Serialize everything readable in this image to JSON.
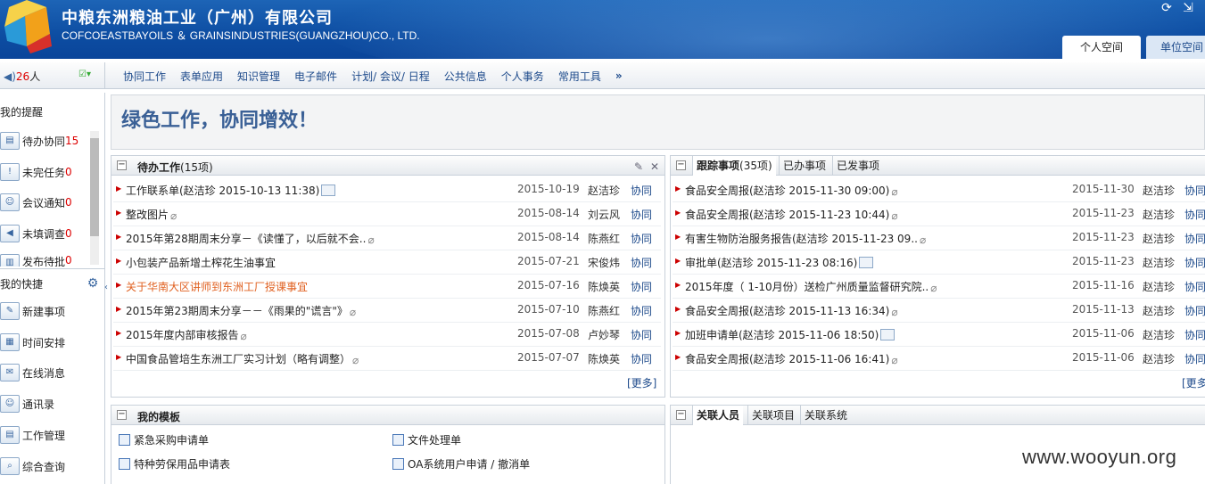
{
  "header": {
    "company_cn": "中粮东洲粮油工业（广州）有限公司",
    "company_en": "COFCOEASTBAYOILS ＆ GRAINSINDUSTRIES(GUANGZHOU)CO., LTD.",
    "tabs": [
      "个人空间",
      "单位空间"
    ]
  },
  "toolbar": {
    "online_count": "26",
    "online_unit": "人",
    "nav": [
      "协同工作",
      "表单应用",
      "知识管理",
      "电子邮件",
      "计划/ 会议/ 日程",
      "公共信息",
      "个人事务",
      "常用工具",
      "»"
    ]
  },
  "sidebar": {
    "reminders_title": "我的提醒",
    "reminders": [
      {
        "label": "待办协同",
        "count": "15"
      },
      {
        "label": "未完任务",
        "count": "0"
      },
      {
        "label": "会议通知",
        "count": "0"
      },
      {
        "label": "未填调查",
        "count": "0"
      },
      {
        "label": "发布待批",
        "count": "0"
      }
    ],
    "shortcuts_title": "我的快捷",
    "shortcuts": [
      "新建事项",
      "时间安排",
      "在线消息",
      "通讯录",
      "工作管理",
      "综合查询"
    ]
  },
  "banner": {
    "slogan": "绿色工作，协同增效！"
  },
  "pending": {
    "title": "待办工作",
    "count": "(15项)",
    "more": "[更多]",
    "rows": [
      {
        "title": "工作联系单(赵洁珍 2015-10-13 11:38)",
        "date": "2015-10-19",
        "user": "赵洁珍",
        "type": "协同",
        "mark": "doc",
        "hl": false
      },
      {
        "title": "整改图片",
        "date": "2015-08-14",
        "user": "刘云风",
        "type": "协同",
        "mark": "att",
        "hl": false
      },
      {
        "title": "2015年第28期周末分享－《读懂了，以后就不会..",
        "date": "2015-08-14",
        "user": "陈燕红",
        "type": "协同",
        "mark": "att",
        "hl": false
      },
      {
        "title": "小包装产品新增土榨花生油事宜",
        "date": "2015-07-21",
        "user": "宋俊炜",
        "type": "协同",
        "mark": "",
        "hl": false
      },
      {
        "title": "关于华南大区讲师到东洲工厂授课事宜",
        "date": "2015-07-16",
        "user": "陈焕英",
        "type": "协同",
        "mark": "",
        "hl": true
      },
      {
        "title": "2015年第23期周末分享－－《雨果的\"谎言\"》",
        "date": "2015-07-10",
        "user": "陈燕红",
        "type": "协同",
        "mark": "att",
        "hl": false
      },
      {
        "title": "2015年度内部审核报告",
        "date": "2015-07-08",
        "user": "卢妙琴",
        "type": "协同",
        "mark": "att",
        "hl": false
      },
      {
        "title": "中国食品管培生东洲工厂实习计划（略有调整）",
        "date": "2015-07-07",
        "user": "陈焕英",
        "type": "协同",
        "mark": "att",
        "hl": false
      }
    ]
  },
  "tracking": {
    "tabs": [
      "跟踪事项",
      "已办事项",
      "已发事项"
    ],
    "count": "(35项)",
    "more": "[更多",
    "rows": [
      {
        "title": "食品安全周报(赵洁珍 2015-11-30 09:00)",
        "date": "2015-11-30",
        "user": "赵洁珍",
        "type": "协同",
        "mark": "att"
      },
      {
        "title": "食品安全周报(赵洁珍 2015-11-23 10:44)",
        "date": "2015-11-23",
        "user": "赵洁珍",
        "type": "协同",
        "mark": "att"
      },
      {
        "title": "有害生物防治服务报告(赵洁珍 2015-11-23 09..",
        "date": "2015-11-23",
        "user": "赵洁珍",
        "type": "协同",
        "mark": "att"
      },
      {
        "title": "审批单(赵洁珍 2015-11-23 08:16)",
        "date": "2015-11-23",
        "user": "赵洁珍",
        "type": "协同",
        "mark": "doc"
      },
      {
        "title": "2015年度（ 1-10月份）送检广州质量监督研究院..",
        "date": "2015-11-16",
        "user": "赵洁珍",
        "type": "协同",
        "mark": "att"
      },
      {
        "title": "食品安全周报(赵洁珍 2015-11-13 16:34)",
        "date": "2015-11-13",
        "user": "赵洁珍",
        "type": "协同",
        "mark": "att"
      },
      {
        "title": "加班申请单(赵洁珍 2015-11-06 18:50)",
        "date": "2015-11-06",
        "user": "赵洁珍",
        "type": "协同",
        "mark": "doc"
      },
      {
        "title": "食品安全周报(赵洁珍 2015-11-06 16:41)",
        "date": "2015-11-06",
        "user": "赵洁珍",
        "type": "协同",
        "mark": "att"
      }
    ]
  },
  "templates": {
    "title": "我的模板",
    "items": [
      "紧急采购申请单",
      "文件处理单",
      "特种劳保用品申请表",
      "OA系统用户申请 / 撤消单"
    ]
  },
  "related": {
    "tabs": [
      "关联人员",
      "关联项目",
      "关联系统"
    ]
  },
  "watermark": "www.wooyun.org"
}
